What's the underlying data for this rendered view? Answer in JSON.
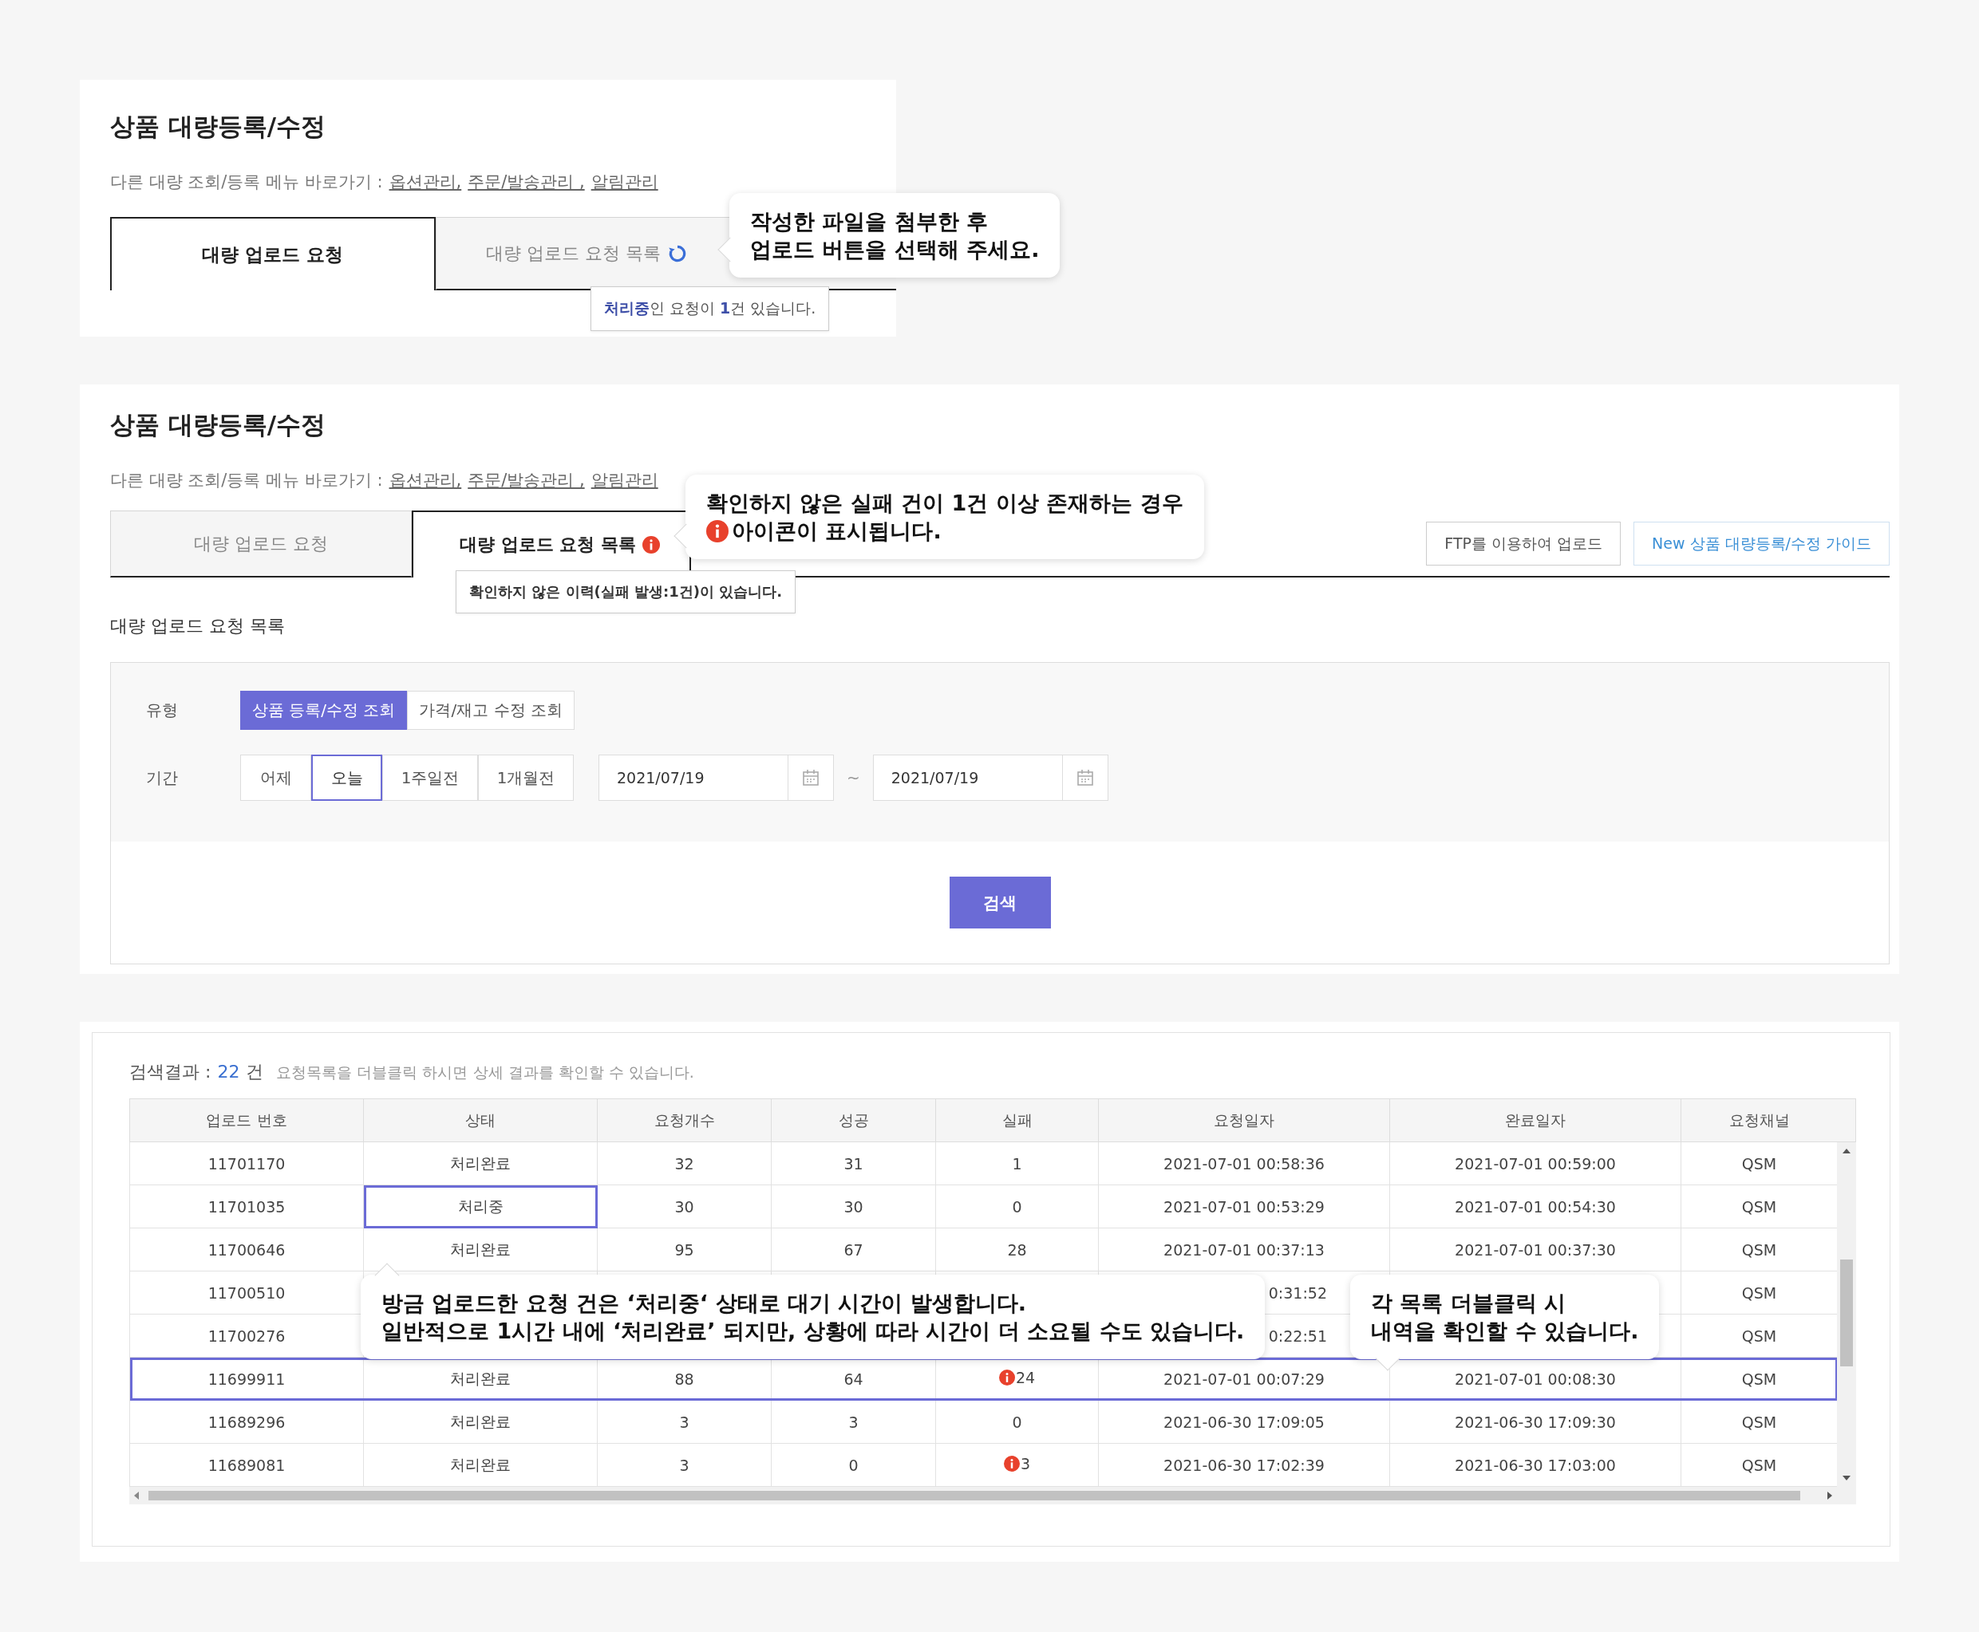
{
  "section_1": {
    "title": "상품 대량등록/수정",
    "shortcut": {
      "label": "다른 대량 조회/등록 메뉴 바로가기 :",
      "links": [
        "옵션관리,",
        "주문/발송관리 ,",
        "알림관리"
      ]
    },
    "tabs": [
      {
        "label": "대량 업로드 요청",
        "selected": true
      },
      {
        "label": "대량 업로드 요청 목록",
        "selected": false
      }
    ],
    "tab_tooltip": "**처리중**인 요청이 **1**건 있습니다.",
    "callout": {
      "lines": [
        "작성한 파일을 첨부한 후",
        "업로드 버튼을 선택해 주세요."
      ]
    }
  },
  "section_2": {
    "title": "상품 대량등록/수정",
    "shortcut": {
      "label": "다른 대량 조회/등록 메뉴 바로가기 :",
      "links": [
        "옵션관리,",
        "주문/발송관리 ,",
        "알림관리"
      ]
    },
    "tabs": [
      {
        "label": "대량 업로드 요청",
        "selected": false
      },
      {
        "label": "대량 업로드 요청 목록",
        "selected": true
      }
    ],
    "tab_tooltip": "확인하지 않은 이력(실패 발생:1건)이 있습니다.",
    "callout": {
      "lines": [
        "확인하지 않은 실패 건이 1건 이상 존재하는 경우",
        "아이콘이 표시됩니다."
      ]
    },
    "buttons": [
      {
        "label": "FTP를 이용하여 업로드",
        "kind": "plain"
      },
      {
        "label": "New 상품 대량등록/수정 가이드",
        "kind": "link"
      }
    ],
    "subtitle": "대량 업로드 요청 목록",
    "filters": {
      "type": {
        "label": "유형",
        "options": [
          {
            "label": "상품 등록/수정 조회",
            "selected": true
          },
          {
            "label": "가격/재고 수정 조회",
            "selected": false
          }
        ]
      },
      "period": {
        "label": "기간",
        "options": [
          {
            "label": "어제",
            "selected": false
          },
          {
            "label": "오늘",
            "selected": true
          },
          {
            "label": "1주일전",
            "selected": false
          },
          {
            "label": "1개월전",
            "selected": false
          }
        ],
        "date_from": "2021/07/19",
        "separator": "~",
        "date_to": "2021/07/19"
      }
    },
    "search_button": "검색"
  },
  "results": {
    "label": "검색결과 :",
    "count": "22",
    "unit": "건",
    "hint": "요청목록을 더블클릭 하시면 상세 결과를 확인할 수 있습니다.",
    "table": {
      "columns": [
        "업로드 번호",
        "상태",
        "요청개수",
        "성공",
        "실패",
        "요청일자",
        "완료일자",
        "요청채널"
      ],
      "rows": [
        {
          "cells": [
            "11701170",
            "처리완료",
            "32",
            "31",
            "1",
            "2021-07-01 00:58:36",
            "2021-07-01 00:59:00",
            "QSM"
          ],
          "selected": false,
          "status_highlight": false,
          "fail_alert": false,
          "covered": false
        },
        {
          "cells": [
            "11701035",
            "처리중",
            "30",
            "30",
            "0",
            "2021-07-01 00:53:29",
            "2021-07-01 00:54:30",
            "QSM"
          ],
          "selected": false,
          "status_highlight": true,
          "fail_alert": false,
          "covered": false
        },
        {
          "cells": [
            "11700646",
            "처리완료",
            "95",
            "67",
            "28",
            "2021-07-01 00:37:13",
            "2021-07-01 00:37:30",
            "QSM"
          ],
          "selected": false,
          "status_highlight": false,
          "fail_alert": false,
          "covered": false
        },
        {
          "cells": [
            "11700510",
            null,
            null,
            null,
            null,
            "0:31:52",
            null,
            "QSM"
          ],
          "selected": false,
          "status_highlight": false,
          "fail_alert": false,
          "covered": true
        },
        {
          "cells": [
            "11700276",
            null,
            null,
            null,
            null,
            "0:22:51",
            null,
            "QSM"
          ],
          "selected": false,
          "status_highlight": false,
          "fail_alert": false,
          "covered": true
        },
        {
          "cells": [
            "11699911",
            "처리완료",
            "88",
            "64",
            "24",
            "2021-07-01 00:07:29",
            "2021-07-01 00:08:30",
            "QSM"
          ],
          "selected": true,
          "status_highlight": false,
          "fail_alert": true,
          "covered": false
        },
        {
          "cells": [
            "11689296",
            "처리완료",
            "3",
            "3",
            "0",
            "2021-06-30 17:09:05",
            "2021-06-30 17:09:30",
            "QSM"
          ],
          "selected": false,
          "status_highlight": false,
          "fail_alert": false,
          "covered": false
        },
        {
          "cells": [
            "11689081",
            "처리완료",
            "3",
            "0",
            "3",
            "2021-06-30 17:02:39",
            "2021-06-30 17:03:00",
            "QSM"
          ],
          "selected": false,
          "status_highlight": false,
          "fail_alert": true,
          "covered": false
        }
      ]
    },
    "callouts": [
      {
        "lines": [
          "방금 업로드한 요청 건은 ‘처리중‘ 상태로 대기 시간이 발생합니다.",
          "일반적으로 1시간 내에 ‘처리완료’ 되지만, 상황에 따라 시간이 더 소요될 수도 있습니다."
        ]
      },
      {
        "lines": [
          "각 목록 더블클릭 시",
          "내역을 확인할 수 있습니다."
        ]
      }
    ]
  }
}
